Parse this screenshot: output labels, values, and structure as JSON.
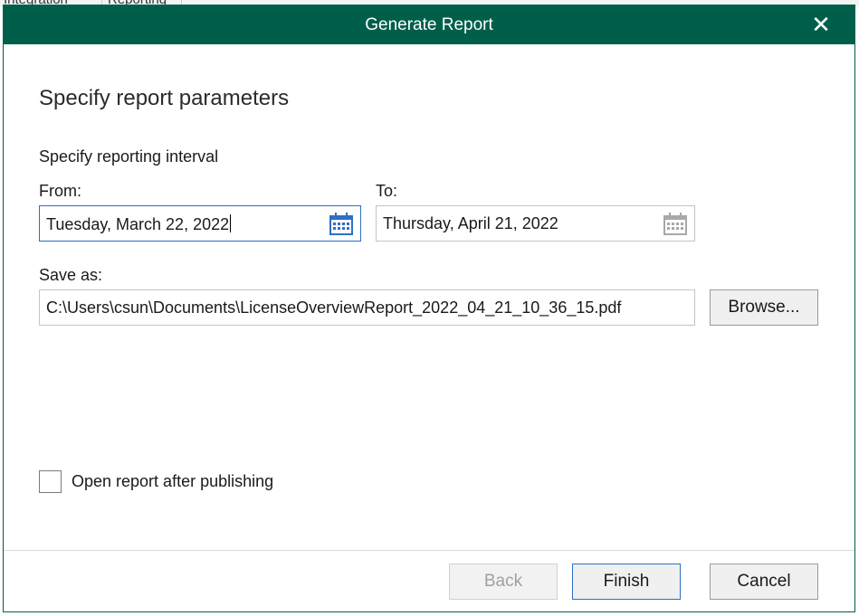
{
  "background_app": {
    "tab1": "Integration",
    "tab2": "Reporting"
  },
  "dialog": {
    "title": "Generate Report",
    "close_icon": "close-icon",
    "heading": "Specify report parameters",
    "interval_label": "Specify reporting interval",
    "from_label": "From:",
    "from_value": "Tuesday, March 22, 2022",
    "to_label": "To:",
    "to_value": "Thursday, April 21, 2022",
    "save_as_label": "Save as:",
    "save_as_value": "C:\\Users\\csun\\Documents\\LicenseOverviewReport_2022_04_21_10_36_15.pdf",
    "browse_label": "Browse...",
    "open_after_label": "Open report after publishing",
    "open_after_checked": false,
    "back_label": "Back",
    "finish_label": "Finish",
    "cancel_label": "Cancel"
  },
  "colors": {
    "titlebar": "#005f4b",
    "focus_border": "#2f6fc4",
    "calendar_active": "#2f6fc4",
    "calendar_inactive": "#a8a8a8"
  }
}
